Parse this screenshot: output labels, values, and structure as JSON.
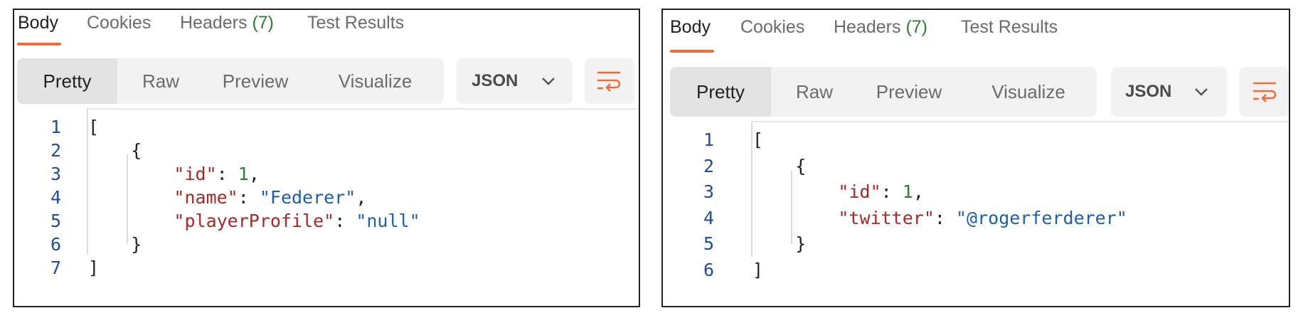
{
  "left": {
    "tabs": [
      {
        "label": "Body",
        "active": true
      },
      {
        "label": "Cookies",
        "active": false
      },
      {
        "label": "Headers",
        "count": "(7)",
        "active": false
      },
      {
        "label": "Test Results",
        "active": false
      }
    ],
    "view_buttons": [
      "Pretty",
      "Raw",
      "Preview",
      "Visualize"
    ],
    "active_view": "Pretty",
    "format": "JSON",
    "lines": [
      {
        "n": "1",
        "tokens": [
          {
            "t": "[",
            "c": "p"
          }
        ]
      },
      {
        "n": "2",
        "tokens": [
          {
            "t": "    {",
            "c": "p"
          }
        ]
      },
      {
        "n": "3",
        "tokens": [
          {
            "t": "        ",
            "c": "p"
          },
          {
            "t": "\"id\"",
            "c": "k"
          },
          {
            "t": ": ",
            "c": "p"
          },
          {
            "t": "1",
            "c": "n"
          },
          {
            "t": ",",
            "c": "p"
          }
        ]
      },
      {
        "n": "4",
        "tokens": [
          {
            "t": "        ",
            "c": "p"
          },
          {
            "t": "\"name\"",
            "c": "k"
          },
          {
            "t": ": ",
            "c": "p"
          },
          {
            "t": "\"Federer\"",
            "c": "s"
          },
          {
            "t": ",",
            "c": "p"
          }
        ]
      },
      {
        "n": "5",
        "tokens": [
          {
            "t": "        ",
            "c": "p"
          },
          {
            "t": "\"playerProfile\"",
            "c": "k"
          },
          {
            "t": ": ",
            "c": "p"
          },
          {
            "t": "\"null\"",
            "c": "s"
          }
        ]
      },
      {
        "n": "6",
        "tokens": [
          {
            "t": "    }",
            "c": "p"
          }
        ]
      },
      {
        "n": "7",
        "tokens": [
          {
            "t": "]",
            "c": "p"
          }
        ]
      }
    ]
  },
  "right": {
    "tabs": [
      {
        "label": "Body",
        "active": true
      },
      {
        "label": "Cookies",
        "active": false
      },
      {
        "label": "Headers",
        "count": "(7)",
        "active": false
      },
      {
        "label": "Test Results",
        "active": false
      }
    ],
    "view_buttons": [
      "Pretty",
      "Raw",
      "Preview",
      "Visualize"
    ],
    "active_view": "Pretty",
    "format": "JSON",
    "lines": [
      {
        "n": "1",
        "tokens": [
          {
            "t": "[",
            "c": "p"
          }
        ]
      },
      {
        "n": "2",
        "tokens": [
          {
            "t": "    {",
            "c": "p"
          }
        ]
      },
      {
        "n": "3",
        "tokens": [
          {
            "t": "        ",
            "c": "p"
          },
          {
            "t": "\"id\"",
            "c": "k"
          },
          {
            "t": ": ",
            "c": "p"
          },
          {
            "t": "1",
            "c": "n"
          },
          {
            "t": ",",
            "c": "p"
          }
        ]
      },
      {
        "n": "4",
        "tokens": [
          {
            "t": "        ",
            "c": "p"
          },
          {
            "t": "\"twitter\"",
            "c": "k"
          },
          {
            "t": ": ",
            "c": "p"
          },
          {
            "t": "\"@rogerferderer\"",
            "c": "s"
          }
        ]
      },
      {
        "n": "5",
        "tokens": [
          {
            "t": "    }",
            "c": "p"
          }
        ]
      },
      {
        "n": "6",
        "tokens": [
          {
            "t": "]",
            "c": "p"
          }
        ]
      }
    ]
  },
  "icons": {
    "format_chevron": "chevron-down-icon",
    "wrap": "wrap-lines-icon"
  },
  "colors": {
    "accent": "#f26b3a",
    "key": "#a52a2a",
    "string": "#1f5fa8",
    "number": "#2e7d32",
    "line_number": "#1f4e9c",
    "header_count": "#2e7d32"
  }
}
